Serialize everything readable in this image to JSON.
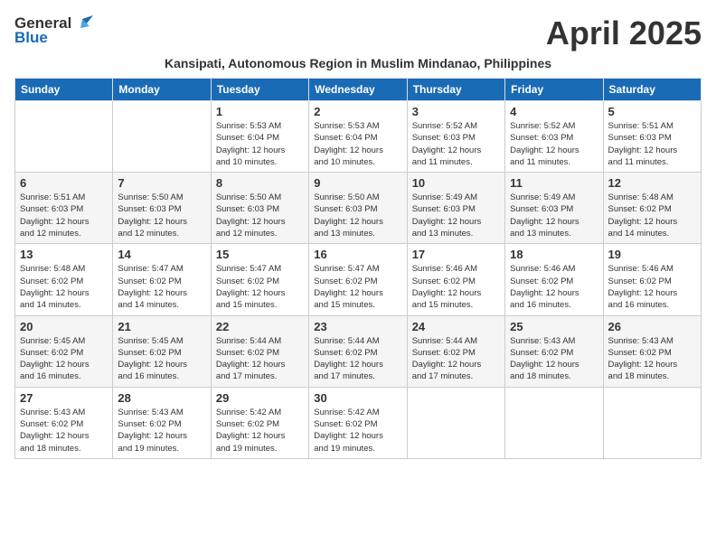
{
  "header": {
    "logo_general": "General",
    "logo_blue": "Blue",
    "title": "April 2025",
    "subtitle": "Kansipati, Autonomous Region in Muslim Mindanao, Philippines"
  },
  "columns": [
    "Sunday",
    "Monday",
    "Tuesday",
    "Wednesday",
    "Thursday",
    "Friday",
    "Saturday"
  ],
  "weeks": [
    [
      {
        "day": "",
        "info": ""
      },
      {
        "day": "",
        "info": ""
      },
      {
        "day": "1",
        "info": "Sunrise: 5:53 AM\nSunset: 6:04 PM\nDaylight: 12 hours\nand 10 minutes."
      },
      {
        "day": "2",
        "info": "Sunrise: 5:53 AM\nSunset: 6:04 PM\nDaylight: 12 hours\nand 10 minutes."
      },
      {
        "day": "3",
        "info": "Sunrise: 5:52 AM\nSunset: 6:03 PM\nDaylight: 12 hours\nand 11 minutes."
      },
      {
        "day": "4",
        "info": "Sunrise: 5:52 AM\nSunset: 6:03 PM\nDaylight: 12 hours\nand 11 minutes."
      },
      {
        "day": "5",
        "info": "Sunrise: 5:51 AM\nSunset: 6:03 PM\nDaylight: 12 hours\nand 11 minutes."
      }
    ],
    [
      {
        "day": "6",
        "info": "Sunrise: 5:51 AM\nSunset: 6:03 PM\nDaylight: 12 hours\nand 12 minutes."
      },
      {
        "day": "7",
        "info": "Sunrise: 5:50 AM\nSunset: 6:03 PM\nDaylight: 12 hours\nand 12 minutes."
      },
      {
        "day": "8",
        "info": "Sunrise: 5:50 AM\nSunset: 6:03 PM\nDaylight: 12 hours\nand 12 minutes."
      },
      {
        "day": "9",
        "info": "Sunrise: 5:50 AM\nSunset: 6:03 PM\nDaylight: 12 hours\nand 13 minutes."
      },
      {
        "day": "10",
        "info": "Sunrise: 5:49 AM\nSunset: 6:03 PM\nDaylight: 12 hours\nand 13 minutes."
      },
      {
        "day": "11",
        "info": "Sunrise: 5:49 AM\nSunset: 6:03 PM\nDaylight: 12 hours\nand 13 minutes."
      },
      {
        "day": "12",
        "info": "Sunrise: 5:48 AM\nSunset: 6:02 PM\nDaylight: 12 hours\nand 14 minutes."
      }
    ],
    [
      {
        "day": "13",
        "info": "Sunrise: 5:48 AM\nSunset: 6:02 PM\nDaylight: 12 hours\nand 14 minutes."
      },
      {
        "day": "14",
        "info": "Sunrise: 5:47 AM\nSunset: 6:02 PM\nDaylight: 12 hours\nand 14 minutes."
      },
      {
        "day": "15",
        "info": "Sunrise: 5:47 AM\nSunset: 6:02 PM\nDaylight: 12 hours\nand 15 minutes."
      },
      {
        "day": "16",
        "info": "Sunrise: 5:47 AM\nSunset: 6:02 PM\nDaylight: 12 hours\nand 15 minutes."
      },
      {
        "day": "17",
        "info": "Sunrise: 5:46 AM\nSunset: 6:02 PM\nDaylight: 12 hours\nand 15 minutes."
      },
      {
        "day": "18",
        "info": "Sunrise: 5:46 AM\nSunset: 6:02 PM\nDaylight: 12 hours\nand 16 minutes."
      },
      {
        "day": "19",
        "info": "Sunrise: 5:46 AM\nSunset: 6:02 PM\nDaylight: 12 hours\nand 16 minutes."
      }
    ],
    [
      {
        "day": "20",
        "info": "Sunrise: 5:45 AM\nSunset: 6:02 PM\nDaylight: 12 hours\nand 16 minutes."
      },
      {
        "day": "21",
        "info": "Sunrise: 5:45 AM\nSunset: 6:02 PM\nDaylight: 12 hours\nand 16 minutes."
      },
      {
        "day": "22",
        "info": "Sunrise: 5:44 AM\nSunset: 6:02 PM\nDaylight: 12 hours\nand 17 minutes."
      },
      {
        "day": "23",
        "info": "Sunrise: 5:44 AM\nSunset: 6:02 PM\nDaylight: 12 hours\nand 17 minutes."
      },
      {
        "day": "24",
        "info": "Sunrise: 5:44 AM\nSunset: 6:02 PM\nDaylight: 12 hours\nand 17 minutes."
      },
      {
        "day": "25",
        "info": "Sunrise: 5:43 AM\nSunset: 6:02 PM\nDaylight: 12 hours\nand 18 minutes."
      },
      {
        "day": "26",
        "info": "Sunrise: 5:43 AM\nSunset: 6:02 PM\nDaylight: 12 hours\nand 18 minutes."
      }
    ],
    [
      {
        "day": "27",
        "info": "Sunrise: 5:43 AM\nSunset: 6:02 PM\nDaylight: 12 hours\nand 18 minutes."
      },
      {
        "day": "28",
        "info": "Sunrise: 5:43 AM\nSunset: 6:02 PM\nDaylight: 12 hours\nand 19 minutes."
      },
      {
        "day": "29",
        "info": "Sunrise: 5:42 AM\nSunset: 6:02 PM\nDaylight: 12 hours\nand 19 minutes."
      },
      {
        "day": "30",
        "info": "Sunrise: 5:42 AM\nSunset: 6:02 PM\nDaylight: 12 hours\nand 19 minutes."
      },
      {
        "day": "",
        "info": ""
      },
      {
        "day": "",
        "info": ""
      },
      {
        "day": "",
        "info": ""
      }
    ]
  ]
}
